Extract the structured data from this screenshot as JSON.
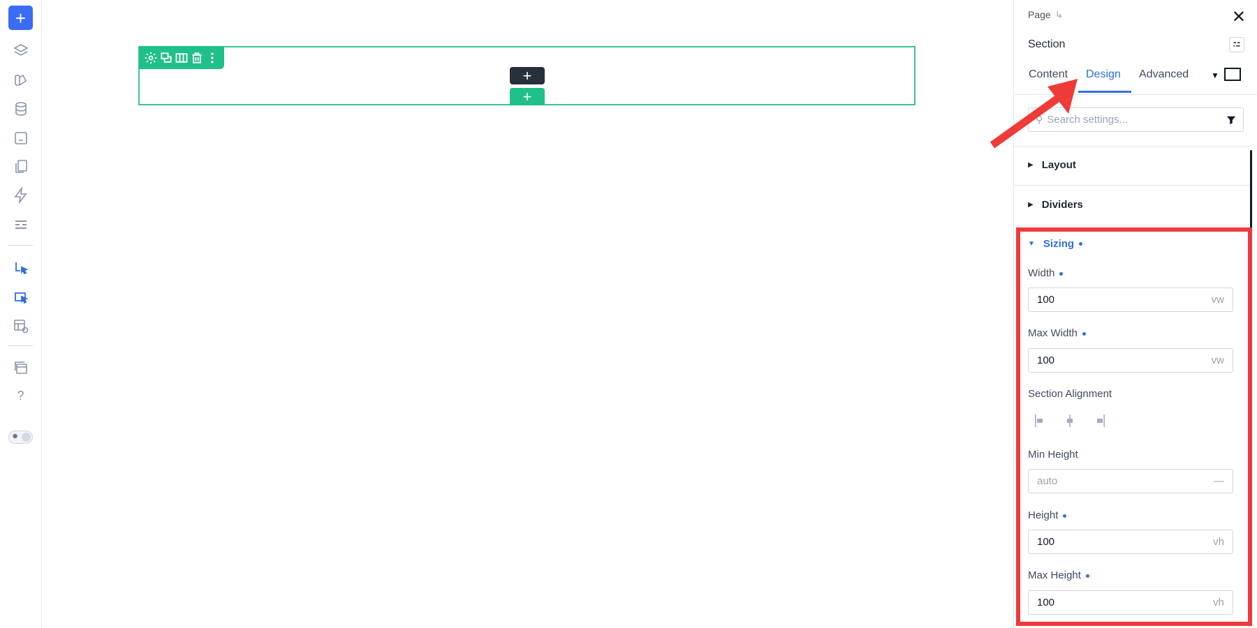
{
  "rail": {
    "add_label": "+",
    "help_label": "?"
  },
  "canvas": {
    "add_inside": "+",
    "add_below": "+"
  },
  "panel": {
    "breadcrumb": "Page",
    "breadcrumb_arrow": "↳",
    "close": "✕",
    "section_title": "Section",
    "tabs": [
      "Content",
      "Design",
      "Advanced"
    ],
    "active_tab": "Design",
    "search_placeholder": "Search settings...",
    "accordions": {
      "layout": "Layout",
      "dividers": "Dividers",
      "sizing": "Sizing"
    },
    "fields": {
      "width": {
        "label": "Width",
        "value": "100",
        "unit": "vw"
      },
      "max_width": {
        "label": "Max Width",
        "value": "100",
        "unit": "vw"
      },
      "section_alignment": {
        "label": "Section Alignment"
      },
      "min_height": {
        "label": "Min Height",
        "value": "auto",
        "unit": "—"
      },
      "height": {
        "label": "Height",
        "value": "100",
        "unit": "vh"
      },
      "max_height": {
        "label": "Max Height",
        "value": "100",
        "unit": "vh"
      }
    }
  },
  "colors": {
    "accent": "#2f6fe0",
    "green": "#1fc08a",
    "annotation_red": "#ef3a3a"
  }
}
